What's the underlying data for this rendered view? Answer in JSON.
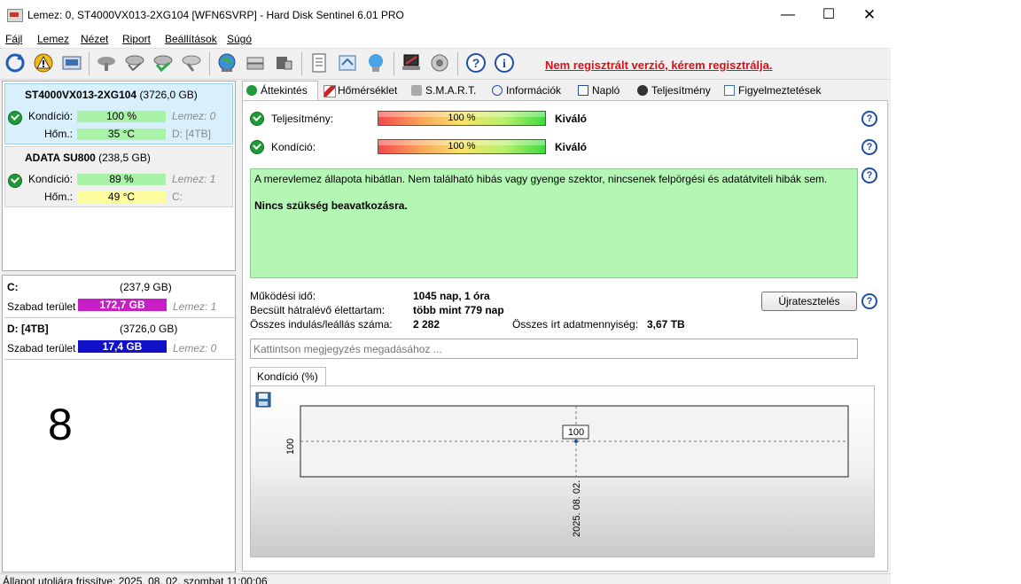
{
  "window": {
    "title": "Lemez: 0, ST4000VX013-2XG104 [WFN6SVRP]  -  Hard Disk Sentinel 6.01 PRO",
    "minimize": "—",
    "maximize": "☐",
    "close": "✕"
  },
  "menu": {
    "items": [
      "Fájl",
      "Lemez",
      "Nézet",
      "Riport",
      "Beállítások",
      "Súgó"
    ]
  },
  "toolbar": {
    "register_link": "Nem regisztrált verzió, kérem regisztrálja."
  },
  "disks": [
    {
      "name": "ST4000VX013-2XG104",
      "size": "(3726,0 GB)",
      "condition_label": "Kondíció:",
      "condition_value": "100 %",
      "condition_fraction": 1.0,
      "temp_label": "Hőm.:",
      "temp_value": "35 °C",
      "disk_ref": "Lemez: 0",
      "drive_ref": "D: [4TB]"
    },
    {
      "name": "ADATA SU800",
      "size": "(238,5 GB)",
      "condition_label": "Kondíció:",
      "condition_value": "89 %",
      "condition_fraction": 0.89,
      "temp_label": "Hőm.:",
      "temp_value": "49 °C",
      "disk_ref": "Lemez: 1",
      "drive_ref": "C:"
    }
  ],
  "partitions": [
    {
      "name": "C:",
      "size": "(237,9 GB)",
      "free_label": "Szabad terület",
      "free_value": "172,7 GB",
      "free_color": "#c81ec8",
      "disk_ref": "Lemez: 1"
    },
    {
      "name": "D: [4TB]",
      "size": "(3726,0 GB)",
      "free_label": "Szabad terület",
      "free_value": "17,4 GB",
      "free_color": "#1010c8",
      "disk_ref": "Lemez: 0"
    }
  ],
  "left_big_number": "8",
  "tabs": [
    "Áttekintés",
    "Hőmérséklet",
    "S.M.A.R.T.",
    "Információk",
    "Napló",
    "Teljesítmény",
    "Figyelmeztetések"
  ],
  "overview": {
    "performance_label": "Teljesítmény:",
    "performance_value": "100 %",
    "performance_rating": "Kiváló",
    "condition_label": "Kondíció:",
    "condition_value": "100 %",
    "condition_rating": "Kiváló",
    "status_text": "A merevlemez állapota hibátlan. Nem található hibás vagy gyenge szektor, nincsenek felpörgési és adatátviteli hibák sem.",
    "status_advice": "Nincs szükség beavatkozásra.",
    "help": "?"
  },
  "stats": {
    "uptime_label": "Működési idő:",
    "uptime_value": "1045 nap, 1 óra",
    "remaining_label": "Becsült hátralévő élettartam:",
    "remaining_value": "több mint 779 nap",
    "startstop_label": "Összes indulás/leállás száma:",
    "startstop_value": "2 282",
    "written_label": "Összes írt adatmennyiség:",
    "written_value": "3,67 TB",
    "reset_button": "Újratesztelés"
  },
  "note": {
    "placeholder": "Kattintson megjegyzés megadásához ..."
  },
  "chart_tab": "Kondíció  (%)",
  "chart_data": {
    "type": "line",
    "x": [
      "2025. 08. 02."
    ],
    "series": [
      {
        "values": [
          100
        ]
      }
    ],
    "ytick": "100",
    "grid": true
  },
  "statusbar": {
    "text": "Állapot utoljára frissítve: 2025. 08. 02. szombat 11:00:06"
  }
}
